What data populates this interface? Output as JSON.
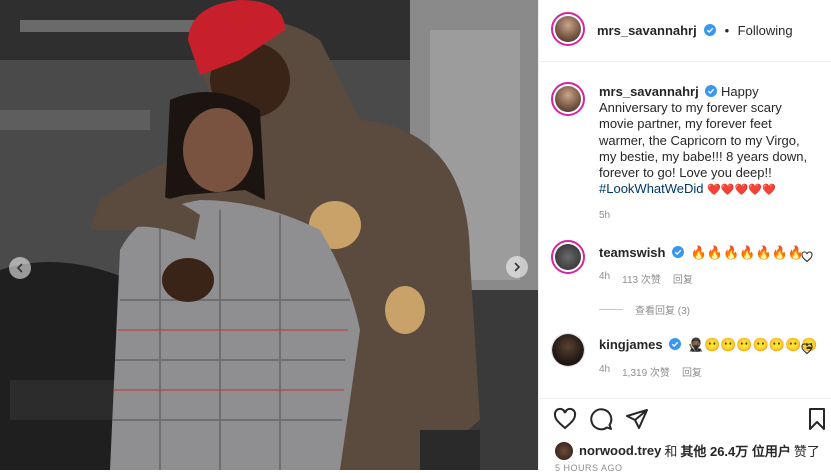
{
  "post": {
    "author": "mrs_savannahrj",
    "following_label": "Following",
    "dot": "•",
    "caption_text": "Happy Anniversary to my forever scary movie partner, my forever feet warmer, the Capricorn to my Virgo, my bestie, my babe!!! 8 years down, forever to go! Love you deep!! ",
    "hashtag": "#LookWhatWeDid",
    "hearts": "❤️❤️❤️❤️❤️",
    "caption_time": "5h"
  },
  "comments": [
    {
      "user": "teamswish",
      "text": "🔥🔥🔥🔥🔥🔥🔥",
      "time": "4h",
      "likes": "113 次赞",
      "reply": "回复",
      "view_replies": "查看回复 (3)"
    },
    {
      "user": "kingjames",
      "text": "🥷🏾😶😶😶😶😶😶😦",
      "time": "4h",
      "likes": "1,319 次赞",
      "reply": "回复"
    }
  ],
  "likes": {
    "user": "norwood.trey",
    "and": "和",
    "others": "其他 26.4万 位用户",
    "liked": "赞了"
  },
  "timestamp": "5 HOURS AGO",
  "icons": {
    "like": "heart-outline-icon",
    "comment": "comment-bubble-icon",
    "share": "paper-plane-icon",
    "save": "bookmark-icon",
    "verified": "verified-badge-icon",
    "prev": "chevron-left-icon",
    "next": "chevron-right-icon"
  },
  "colors": {
    "verified": "#3897f0",
    "hashtag": "#00376b",
    "meta": "#8e8e8e",
    "ring": "#d6249f"
  }
}
